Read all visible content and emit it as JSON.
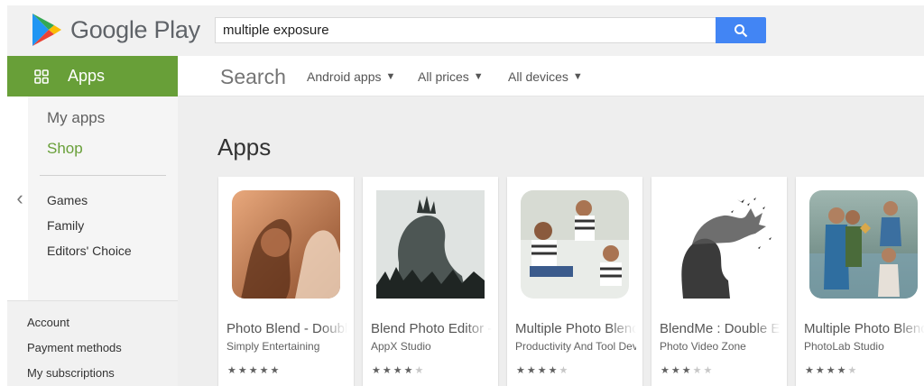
{
  "header": {
    "logo_text": "Google Play",
    "search_value": "multiple exposure"
  },
  "nav": {
    "apps_label": "Apps",
    "my_apps": "My apps",
    "shop": "Shop",
    "categories": [
      "Games",
      "Family",
      "Editors' Choice"
    ],
    "account_links": [
      "Account",
      "Payment methods",
      "My subscriptions"
    ]
  },
  "subbar": {
    "title": "Search",
    "filters": [
      "Android apps",
      "All prices",
      "All devices"
    ]
  },
  "main": {
    "section_title": "Apps",
    "cards": [
      {
        "title": "Photo Blend - Double Exposure",
        "developer": "Simply Entertaining",
        "rating": 4.5
      },
      {
        "title": "Blend Photo Editor - Double Exposure",
        "developer": "AppX Studio",
        "rating": 3.5
      },
      {
        "title": "Multiple Photo Blender",
        "developer": "Productivity And Tool Developer",
        "rating": 4.0
      },
      {
        "title": "BlendMe : Double Exposure",
        "developer": "Photo Video Zone",
        "rating": 2.5
      },
      {
        "title": "Multiple Photo Blender",
        "developer": "PhotoLab Studio",
        "rating": 4.5
      }
    ]
  },
  "colors": {
    "brand_green": "#689f38",
    "search_blue": "#4285f4"
  }
}
